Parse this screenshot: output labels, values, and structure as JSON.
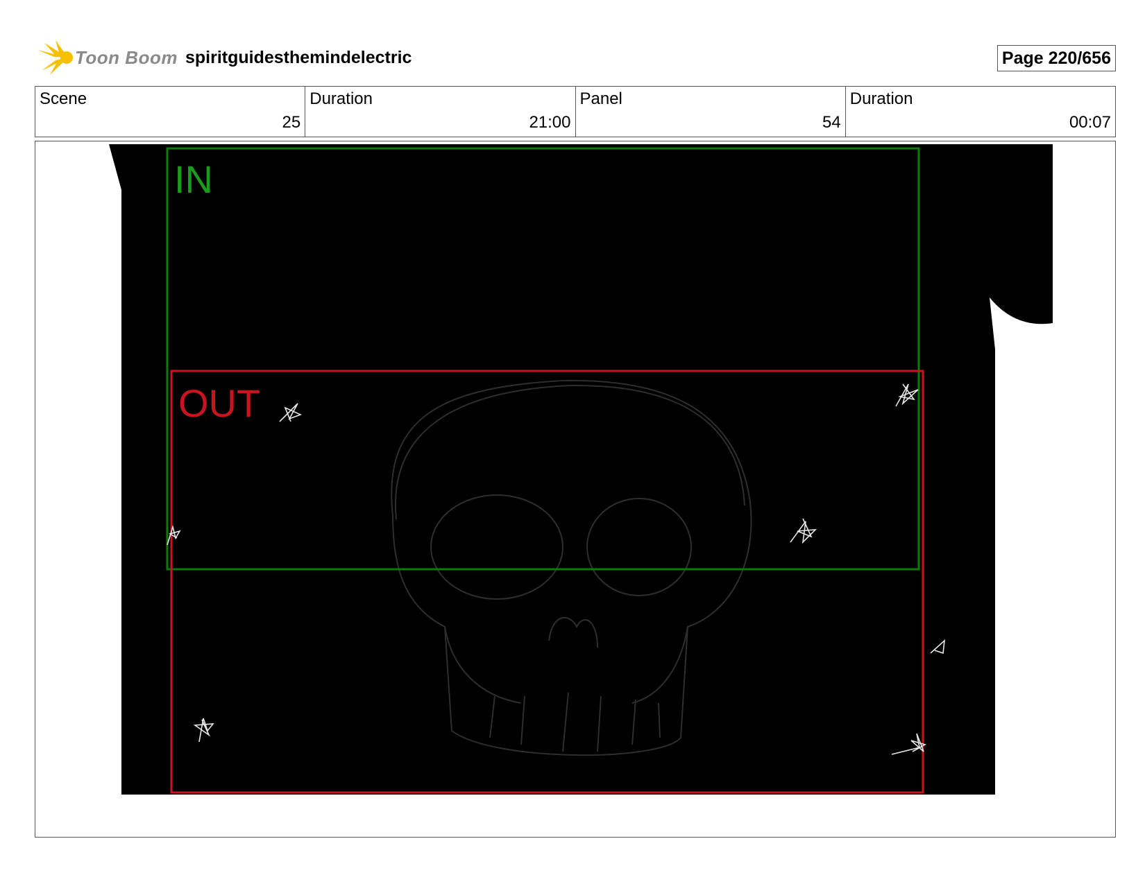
{
  "header": {
    "logo_text": "Toon Boom",
    "project": "spiritguidesthemindelectric",
    "page": "Page 220/656"
  },
  "info": {
    "scene_label": "Scene",
    "scene_value": "25",
    "duration1_label": "Duration",
    "duration1_value": "21:00",
    "panel_label": "Panel",
    "panel_value": "54",
    "duration2_label": "Duration",
    "duration2_value": "00:07"
  },
  "frame": {
    "in_label": "IN",
    "out_label": "OUT",
    "in_color": "#1a9e1a",
    "out_color": "#c8141e"
  },
  "colors": {
    "logo_star": "#f5c000",
    "canvas": "#000000"
  }
}
